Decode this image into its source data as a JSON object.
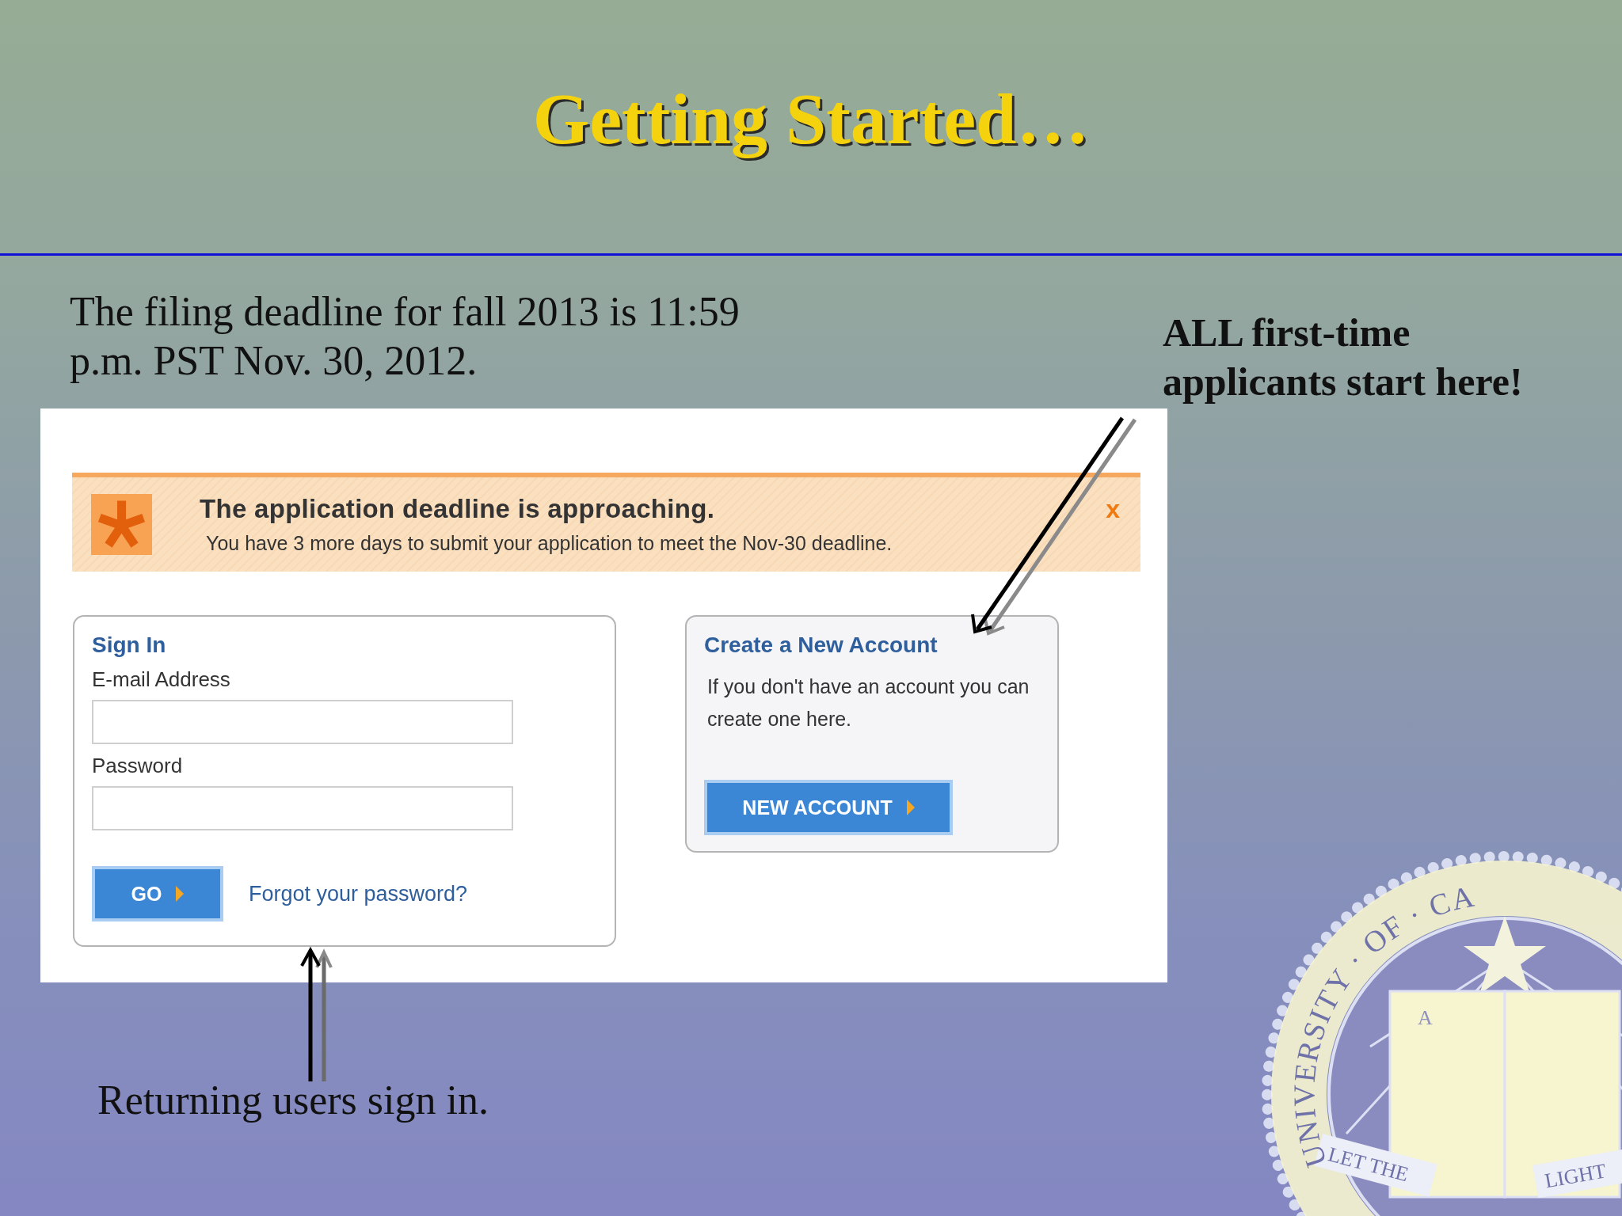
{
  "slide": {
    "title": "Getting Started…",
    "deadline_text": "The filing deadline for fall 2013 is 11:59 p.m. PST Nov. 30, 2012.",
    "callout_new": "ALL first-time applicants start here!",
    "callout_returning": "Returning users sign in."
  },
  "screenshot": {
    "alert": {
      "title": "The application deadline is approaching.",
      "message": "You have 3 more days to submit your application to meet the Nov-30 deadline.",
      "close": "x"
    },
    "sign_in": {
      "heading": "Sign In",
      "fields": [
        {
          "label": "E-mail Address"
        },
        {
          "label": "Password"
        }
      ],
      "button": "GO",
      "link": "Forgot your password?"
    },
    "new_account": {
      "heading": "Create a New Account",
      "text": "If you don't have an account you can create one here.",
      "button": "NEW ACCOUNT"
    }
  },
  "seal": {
    "ring_text": "UNIVERSITY · OF · CA",
    "book_letter": "A",
    "ribbon_left": "LET THE",
    "ribbon_right": "LIGHT"
  }
}
